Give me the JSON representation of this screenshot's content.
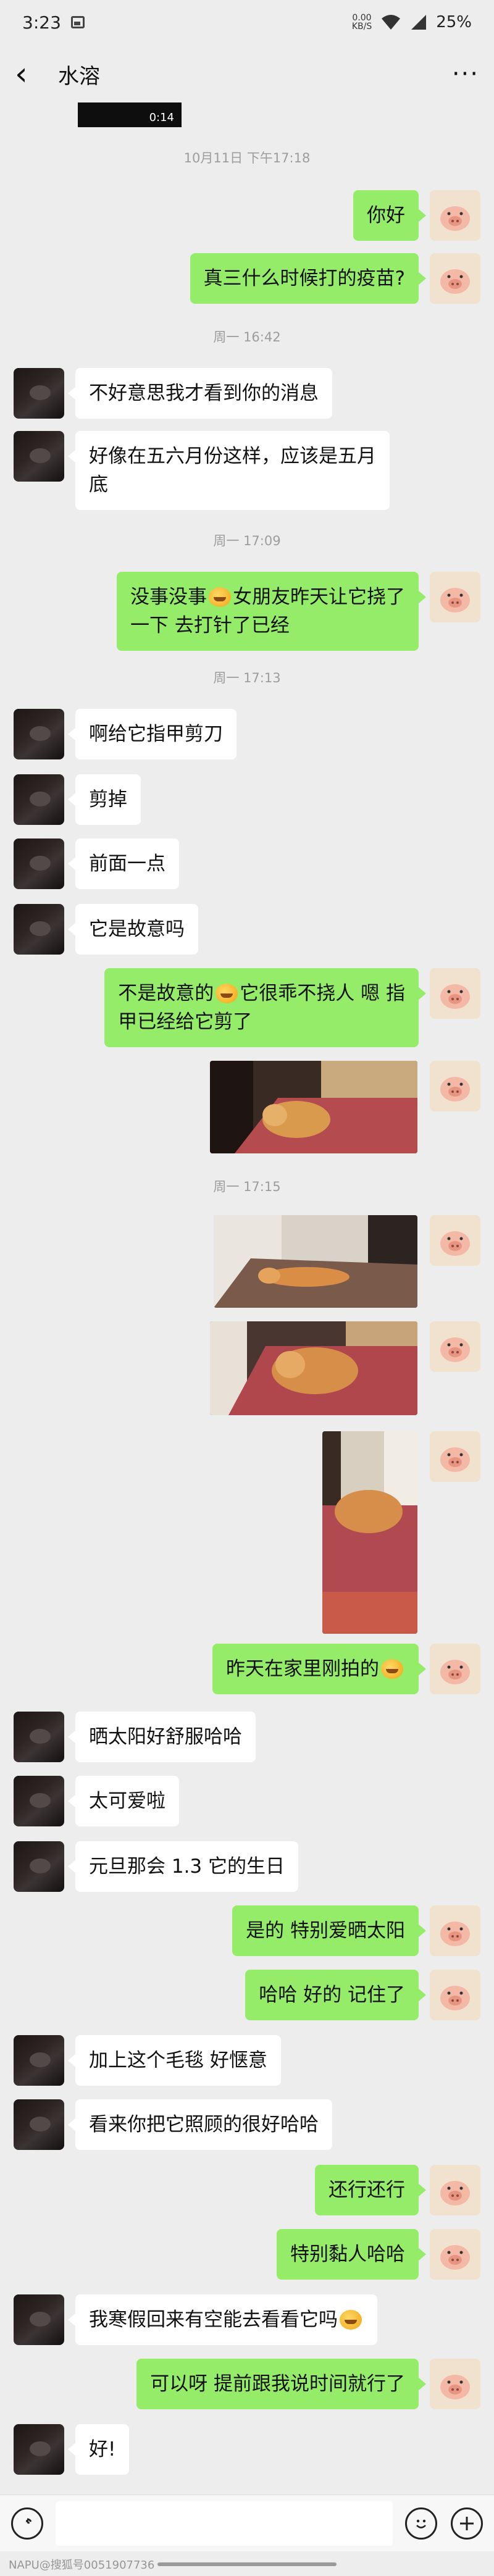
{
  "status_bar": {
    "time": "3:23",
    "net_speed": "0.00",
    "net_unit": "KB/S",
    "battery": "25%"
  },
  "header": {
    "title": "水溶",
    "more_label": "···"
  },
  "video_duration": "0:14",
  "timestamps": [
    "10月11日 下午17:18",
    "周一 16:42",
    "周一 17:09",
    "周一 17:13",
    "周一 17:15"
  ],
  "messages": [
    {
      "side": "me",
      "text": "你好"
    },
    {
      "side": "me",
      "text": "真三什么时候打的疫苗?"
    },
    {
      "side": "them",
      "text": "不好意思我才看到你的消息"
    },
    {
      "side": "them",
      "line1": "好像在五六月份这样，应该是五月",
      "line2": "底"
    },
    {
      "side": "me",
      "line1a": "没事没事",
      "line1b": "女朋友昨天让它挠了",
      "line2": "一下 去打针了已经"
    },
    {
      "side": "them",
      "text": "啊给它指甲剪刀"
    },
    {
      "side": "them",
      "text": "剪掉"
    },
    {
      "side": "them",
      "text": "前面一点"
    },
    {
      "side": "them",
      "text": "它是故意吗"
    },
    {
      "side": "me",
      "line1a": "不是故意的",
      "line1b": "它很乖不挠人 嗯 指",
      "line2": "甲已经给它剪了"
    },
    {
      "side": "me",
      "text": "昨天在家里刚拍的"
    },
    {
      "side": "them",
      "text": "晒太阳好舒服哈哈"
    },
    {
      "side": "them",
      "text": "太可爱啦"
    },
    {
      "side": "them",
      "text": "元旦那会 1.3 它的生日"
    },
    {
      "side": "me",
      "text": "是的 特别爱晒太阳"
    },
    {
      "side": "me",
      "text": "哈哈 好的 记住了"
    },
    {
      "side": "them",
      "text": "加上这个毛毯 好惬意"
    },
    {
      "side": "them",
      "text": "看来你把它照顾的很好哈哈"
    },
    {
      "side": "me",
      "text": "还行还行"
    },
    {
      "side": "me",
      "text": "特别黏人哈哈"
    },
    {
      "side": "them",
      "text": "我寒假回来有空能去看看它吗"
    },
    {
      "side": "me",
      "text": "可以呀 提前跟我说时间就行了"
    },
    {
      "side": "them",
      "text": "好!"
    }
  ],
  "icons": {
    "back": "chevron-left-icon",
    "more": "more-icon",
    "voice": "voice-icon",
    "emoji": "emoji-icon",
    "add": "add-icon",
    "photo": "cat-photo"
  },
  "colors": {
    "bg": "#ededed",
    "me_bubble": "#95ec69",
    "them_bubble": "#ffffff",
    "timestamp": "#9d9d9d"
  },
  "watermark": "NAPU@搜狐号0051907736"
}
